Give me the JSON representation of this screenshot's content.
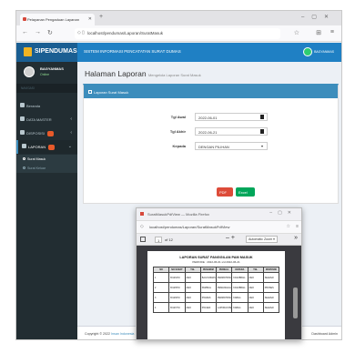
{
  "browser": {
    "tab_title": "Pelayanan Pengaduan Layanan",
    "url": "localhost/pendumas/Laporan/SuratMasuk"
  },
  "app": {
    "brand": "SIPENDUMAS",
    "title": "SISTEM INFORMASI PENCATATAN SURAT DUMAS",
    "user_name": "BAGYANMAS",
    "user_status": "Online",
    "nav_header": "NAVIGASI"
  },
  "sidebar": {
    "items": [
      {
        "label": "Beranda"
      },
      {
        "label": "DATA MASTER"
      },
      {
        "label": "DISPOSISI"
      },
      {
        "label": "LAPORAN"
      }
    ],
    "subitems": [
      {
        "label": "Surat Masuk"
      },
      {
        "label": "Surat Keluar"
      }
    ]
  },
  "page": {
    "title": "Halaman Laporan",
    "subtitle": "Mengelola Laporan Surat Masuk"
  },
  "card": {
    "title": "Laporan Surat Masuk",
    "fields": [
      {
        "label": "Tgl Awal",
        "value": "2022-06-01"
      },
      {
        "label": "Tgl Akhir",
        "value": "2022-06-21"
      },
      {
        "label": "Kepada",
        "value": "DENGAN PILIHAN"
      }
    ],
    "pdf_label": "PDF",
    "excel_label": "Excel"
  },
  "footer": {
    "copyright_prefix": "Copyright © 2022",
    "copyright_link": "Insan Indonesia",
    "right": "Dashboard Admin"
  },
  "popup": {
    "title": "SuratMasukPdfView — Mozilla Firefox",
    "url": "localhost/pendumas/Laporan/SuratMasukPdfView",
    "page_current": "1",
    "page_of": "of 12",
    "zoom": "Automatic Zoom",
    "report_title": "LAPORAN SURAT PANGGILAN PAM MASUK",
    "report_period": "PERIODE : 2022-06-01 s/d 2022-06-21",
    "columns": [
      "NO",
      "NO SURAT",
      "TGL",
      "PENGIRIM",
      "PERIHAL",
      "KEPADA",
      "TGL",
      "DISPOSISI"
    ],
    "rows": [
      [
        "1",
        "B/1234/VI",
        "2022",
        "BAGYANMAS",
        "PERMOHONAN PANGGILAN",
        "KASUBBAG",
        "2022",
        "SELESAI"
      ],
      [
        "2",
        "B/1235/VI",
        "2022",
        "PAMINAL",
        "PEMANGGILAN ANGGOTA",
        "KASUBBAG",
        "2022",
        "PROSES"
      ],
      [
        "3",
        "B/1236/VI",
        "2022",
        "POLRES",
        "PERMOHONAN BANTUAN",
        "KABAG",
        "2022",
        "SELESAI"
      ],
      [
        "4",
        "B/1237/VI",
        "2022",
        "POLSEK",
        "LAPORAN PENGADUAN",
        "KABAG",
        "2022",
        "SELESAI"
      ]
    ]
  }
}
